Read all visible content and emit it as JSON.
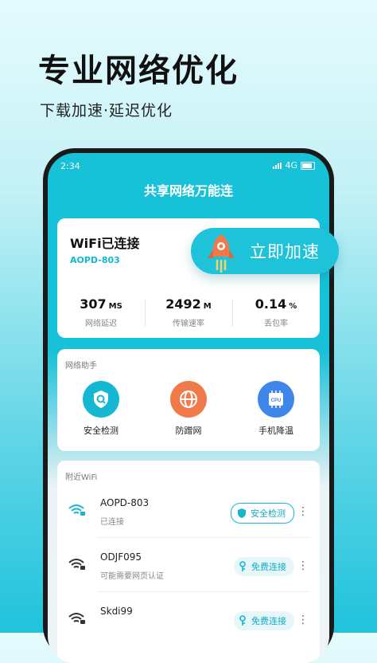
{
  "promo": {
    "headline": "专业网络优化",
    "subline": "下载加速·延迟优化"
  },
  "statusbar": {
    "time": "2:34",
    "network": "4G"
  },
  "app": {
    "title": "共享网络万能连"
  },
  "connection": {
    "status": "WiFi已连接",
    "ssid": "AOPD-803",
    "boost_label": "立即加速"
  },
  "stats": [
    {
      "value": "307",
      "unit": "MS",
      "label": "网络延迟"
    },
    {
      "value": "2492",
      "unit": "M",
      "label": "传输速率"
    },
    {
      "value": "0.14",
      "unit": "%",
      "label": "丢包率"
    }
  ],
  "assistant": {
    "title": "网络助手",
    "tools": [
      {
        "label": "安全检测",
        "icon": "shield-search-icon",
        "color": "#14b8d2"
      },
      {
        "label": "防蹭网",
        "icon": "globe-icon",
        "color": "#f07a4a"
      },
      {
        "label": "手机降温",
        "icon": "cpu-icon",
        "color": "#3f86ea"
      }
    ]
  },
  "nearby": {
    "title": "附近WiFi",
    "networks": [
      {
        "ssid": "AOPD-803",
        "status": "已连接",
        "action": "安全检测"
      },
      {
        "ssid": "ODJF095",
        "status": "可能需要网页认证",
        "action": "免费连接"
      },
      {
        "ssid": "Skdi99",
        "status": "",
        "action": "免费连接"
      }
    ]
  },
  "colors": {
    "accent": "#17c1d8",
    "text": "#111111"
  }
}
